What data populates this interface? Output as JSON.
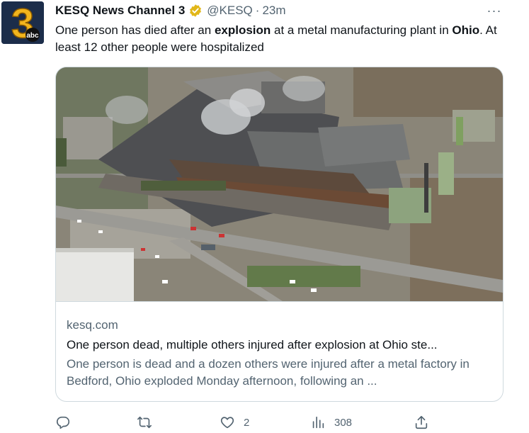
{
  "tweet": {
    "author_name": "KESQ News Channel 3",
    "handle": "@KESQ",
    "separator": "·",
    "time": "23m",
    "more_label": "···",
    "text_parts": [
      "One person has died after an ",
      "explosion",
      " at a metal manufacturing plant in ",
      "Ohio",
      ". At least 12 other people were hospitalized"
    ]
  },
  "avatar": {
    "label": "3",
    "network": "abc"
  },
  "card": {
    "domain": "kesq.com",
    "title": "One person dead, multiple others injured after explosion at Ohio ste...",
    "description": "One person is dead and a dozen others were injured after a metal factory in Bedford, Ohio exploded Monday afternoon, following an ..."
  },
  "actions": {
    "reply": {
      "icon": "reply-icon"
    },
    "retweet": {
      "icon": "retweet-icon"
    },
    "like": {
      "icon": "heart-icon",
      "count": "2"
    },
    "views": {
      "icon": "analytics-icon",
      "count": "308"
    },
    "share": {
      "icon": "share-icon"
    }
  },
  "colors": {
    "text_primary": "#0f1419",
    "text_secondary": "#536471",
    "border": "#cfd9de",
    "verified_gold": "#e2b719",
    "avatar_gold": "#f2b51d"
  }
}
